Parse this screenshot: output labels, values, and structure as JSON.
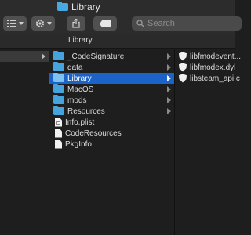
{
  "window": {
    "title": "Library"
  },
  "toolbar": {
    "view_icon": "grid-icon",
    "action_icon": "gear-icon",
    "share_icon": "share-icon",
    "tag_icon": "tag-icon",
    "search_placeholder": "Search"
  },
  "path_bar": {
    "label": "Library"
  },
  "column2": {
    "items": [
      {
        "label": "_CodeSignature",
        "kind": "folder",
        "chevron": true
      },
      {
        "label": "data",
        "kind": "folder",
        "chevron": true
      },
      {
        "label": "Library",
        "kind": "folder",
        "chevron": true,
        "selected": true
      },
      {
        "label": "MacOS",
        "kind": "folder",
        "chevron": true
      },
      {
        "label": "mods",
        "kind": "folder",
        "chevron": true
      },
      {
        "label": "Resources",
        "kind": "folder",
        "chevron": true
      },
      {
        "label": "Info.plist",
        "kind": "plist"
      },
      {
        "label": "CodeResources",
        "kind": "document"
      },
      {
        "label": "PkgInfo",
        "kind": "document"
      }
    ]
  },
  "column3": {
    "items": [
      {
        "label": "libfmodevent...",
        "kind": "dylib"
      },
      {
        "label": "libfmodex.dyl",
        "kind": "dylib"
      },
      {
        "label": "libsteam_api.c",
        "kind": "dylib"
      }
    ]
  },
  "colors": {
    "selection": "#1b63c9",
    "folder": "#45a3de",
    "background": "#1e1e1e"
  }
}
